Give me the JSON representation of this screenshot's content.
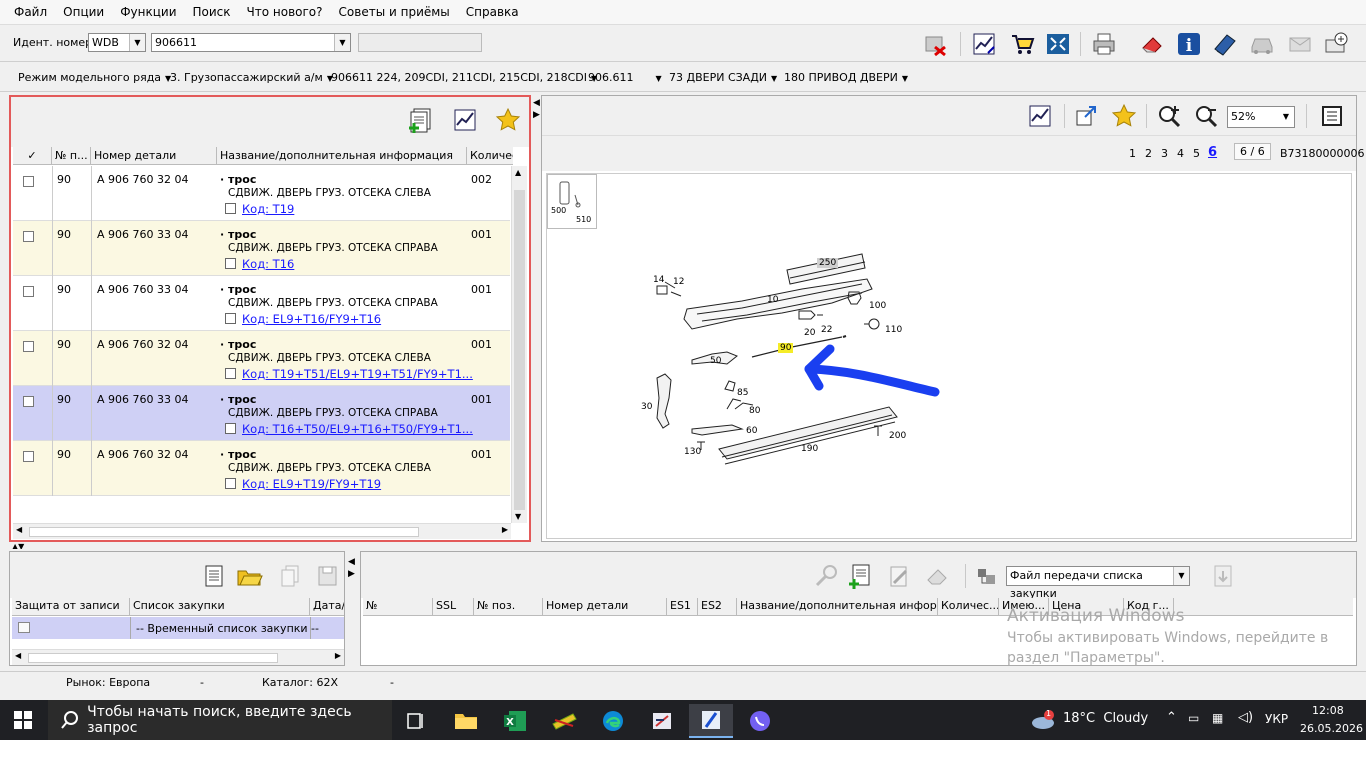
{
  "menu": [
    "Файл",
    "Опции",
    "Функции",
    "Поиск",
    "Что нового?",
    "Советы и приёмы",
    "Справка"
  ],
  "ident": {
    "label": "Идент. номер",
    "prefix": "WDB",
    "number": "906611"
  },
  "model_path": [
    {
      "label": "Режим модельного ряда"
    },
    {
      "label": "3. Грузопассажирский а/м"
    },
    {
      "label": "906611 224, 209CDI, 211CDI, 215CDI, 218CDI"
    },
    {
      "label": "906.611"
    },
    {
      "label": "73 ДВЕРИ СЗАДИ"
    },
    {
      "label": "180 ПРИВОД ДВЕРИ"
    }
  ],
  "parts_table": {
    "headers": [
      "✓",
      "№ п...",
      "Номер детали",
      "Название/дополнительная информация",
      "Количес"
    ],
    "rows": [
      {
        "pos": "90",
        "part": "A 906 760 32 04",
        "name": "трос",
        "desc": "СДВИЖ. ДВЕРЬ ГРУЗ. ОТСЕКА СЛЕВА",
        "code": "Код: T19",
        "qty": "002",
        "bg": "#ffffff"
      },
      {
        "pos": "90",
        "part": "A 906 760 33 04",
        "name": "трос",
        "desc": "СДВИЖ. ДВЕРЬ ГРУЗ. ОТСЕКА СПРАВА",
        "code": "Код: T16",
        "qty": "001",
        "bg": "#fbf8e2"
      },
      {
        "pos": "90",
        "part": "A 906 760 33 04",
        "name": "трос",
        "desc": "СДВИЖ. ДВЕРЬ ГРУЗ. ОТСЕКА СПРАВА",
        "code": "Код: EL9+T16/FY9+T16",
        "qty": "001",
        "bg": "#ffffff"
      },
      {
        "pos": "90",
        "part": "A 906 760 32 04",
        "name": "трос",
        "desc": "СДВИЖ. ДВЕРЬ ГРУЗ. ОТСЕКА СЛЕВА",
        "code": "Код: T19+T51/EL9+T19+T51/FY9+T1...",
        "qty": "001",
        "bg": "#fbf8e2"
      },
      {
        "pos": "90",
        "part": "A 906 760 33 04",
        "name": "трос",
        "desc": "СДВИЖ. ДВЕРЬ ГРУЗ. ОТСЕКА СПРАВА",
        "code": "Код: T16+T50/EL9+T16+T50/FY9+T1...",
        "qty": "001",
        "bg": "#cfd0f5"
      },
      {
        "pos": "90",
        "part": "A 906 760 32 04",
        "name": "трос",
        "desc": "СДВИЖ. ДВЕРЬ ГРУЗ. ОТСЕКА СЛЕВА",
        "code": "Код: EL9+T19/FY9+T19",
        "qty": "001",
        "bg": "#fbf8e2"
      }
    ]
  },
  "viewer": {
    "zoom": "52%",
    "pages": [
      "1",
      "2",
      "3",
      "4",
      "5",
      "6"
    ],
    "current_page": "6",
    "page_count": "6 / 6",
    "image_id": "B73180000006",
    "thumb_labels": [
      "500",
      "510"
    ],
    "callouts": [
      "250",
      "14",
      "12",
      "10",
      "100",
      "20",
      "22",
      "110",
      "90",
      "50",
      "85",
      "30",
      "80",
      "60",
      "190",
      "200",
      "130"
    ]
  },
  "shopping_list": {
    "headers": [
      "Защита от записи",
      "Список закупки",
      "Дата/"
    ],
    "row": "-- Временный список закупки --"
  },
  "transfer": {
    "file_label": "Файл передачи списка закупки",
    "headers": [
      "№",
      "SSL",
      "№ поз.",
      "Номер детали",
      "ES1",
      "ES2",
      "Название/дополнительная информ...",
      "Количес...",
      "Имею...",
      "Цена",
      "Код г..."
    ]
  },
  "watermark": {
    "title": "Активация Windows",
    "line1": "Чтобы активировать Windows, перейдите в",
    "line2": "раздел \"Параметры\"."
  },
  "status": {
    "market": "Рынок: Европа",
    "dash1": "-",
    "catalog": "Каталог: 62X",
    "dash2": "-"
  },
  "taskbar": {
    "search": "Чтобы начать поиск, введите здесь запрос",
    "weather": "18°C  Cloudy",
    "lang": "УКР",
    "time": "12:08",
    "date": "26.05.2026",
    "notif": "1"
  }
}
